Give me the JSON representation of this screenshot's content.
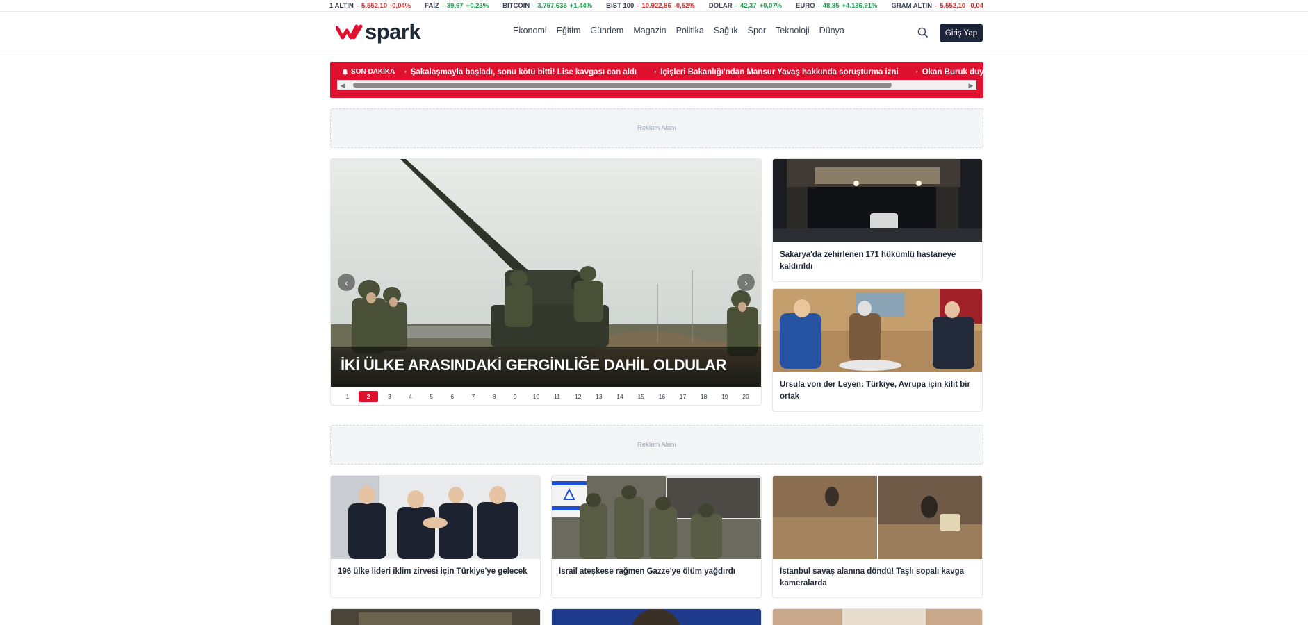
{
  "ticker": [
    {
      "name": "1 ALTIN",
      "value": "5.552,10",
      "change": "-0,04%",
      "dir": "down"
    },
    {
      "name": "FAİZ",
      "value": "39,67",
      "change": "+0,23%",
      "dir": "up"
    },
    {
      "name": "BITCOIN",
      "value": "3.757.635",
      "change": "+1,44%",
      "dir": "up"
    },
    {
      "name": "BIST 100",
      "value": "10.922,86",
      "change": "-0,52%",
      "dir": "down"
    },
    {
      "name": "DOLAR",
      "value": "42,37",
      "change": "+0,07%",
      "dir": "up"
    },
    {
      "name": "EURO",
      "value": "48,85",
      "change": "+4.136,91%",
      "dir": "up"
    },
    {
      "name": "GRAM ALTIN",
      "value": "5.552,10",
      "change": "-0,04",
      "dir": "down"
    }
  ],
  "header": {
    "logo_text": "spark",
    "nav": [
      "Ekonomi",
      "Eğitim",
      "Gündem",
      "Magazin",
      "Politika",
      "Sağlık",
      "Spor",
      "Teknoloji",
      "Dünya"
    ],
    "login_label": "Giriş Yap"
  },
  "breaking": {
    "label": "SON DAKİKA",
    "items": [
      "Şakalaşmayla başladı, sonu kötü bitti! Lise kavgası can aldı",
      "İçişleri Bakanlığı'ndan Mansur Yavaş hakkında soruşturma izni",
      "Okan Buruk duyurdu: Sa"
    ]
  },
  "ads": {
    "top": "Reklam Alanı",
    "middle": "Reklam Alanı"
  },
  "slider": {
    "title": "İKİ ÜLKE ARASINDAKİ GERGİNLİĞE DAHİL OLDULAR",
    "pages": [
      "1",
      "2",
      "3",
      "4",
      "5",
      "6",
      "7",
      "8",
      "9",
      "10",
      "11",
      "12",
      "13",
      "14",
      "15",
      "16",
      "17",
      "18",
      "19",
      "20"
    ],
    "active_page": "2"
  },
  "side_news": [
    {
      "title": "Sakarya'da zehirlenen 171 hükümlü hastaneye kaldırıldı"
    },
    {
      "title": "Ursula von der Leyen: Türkiye, Avrupa için kilit bir ortak"
    }
  ],
  "grid_news": [
    {
      "title": "196 ülke lideri iklim zirvesi için Türkiye'ye gelecek"
    },
    {
      "title": "İsrail ateşkese rağmen Gazze'ye ölüm yağdırdı"
    },
    {
      "title": "İstanbul savaş alanına döndü! Taşlı sopalı kavga kameralarda"
    }
  ],
  "colors": {
    "brand_red": "#e0102f",
    "dark_button": "#1e2538",
    "up": "#16a34a",
    "down": "#dc2626"
  }
}
